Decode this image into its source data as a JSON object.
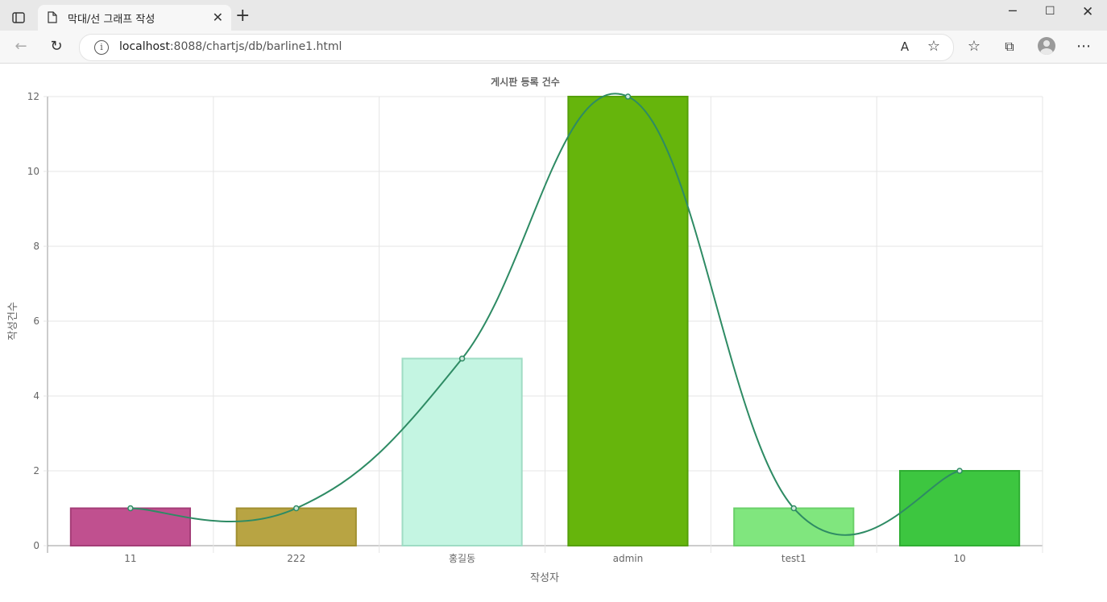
{
  "browser": {
    "tab_title": "막대/선 그래프 작성",
    "close_tab_symbol": "✕",
    "new_tab_symbol": "+",
    "url_host": "localhost",
    "url_path": ":8088/chartjs/db/barline1.html"
  },
  "chart_data": {
    "type": "bar",
    "title": "게시판 등록 건수",
    "xlabel": "작성자",
    "ylabel": "작성건수",
    "categories": [
      "11",
      "222",
      "홍길동",
      "admin",
      "test1",
      "10"
    ],
    "ylim": [
      0,
      12
    ],
    "yticks": [
      0,
      2,
      4,
      6,
      8,
      10,
      12
    ],
    "grid": true,
    "legend": "none",
    "series": [
      {
        "type": "bar",
        "values": [
          1,
          1,
          5,
          12,
          1,
          2
        ],
        "colors": [
          "#c0508f",
          "#b8a443",
          "#c4f5e2",
          "#66b50c",
          "#80e67e",
          "#3dc640"
        ],
        "border_colors": [
          "#a43d77",
          "#a08f30",
          "#9fdcc4",
          "#55a00a",
          "#6ad069",
          "#2fae33"
        ]
      },
      {
        "type": "line",
        "smooth": true,
        "values": [
          1,
          1,
          5,
          12,
          1,
          2
        ],
        "color": "#2e8b64"
      }
    ]
  }
}
